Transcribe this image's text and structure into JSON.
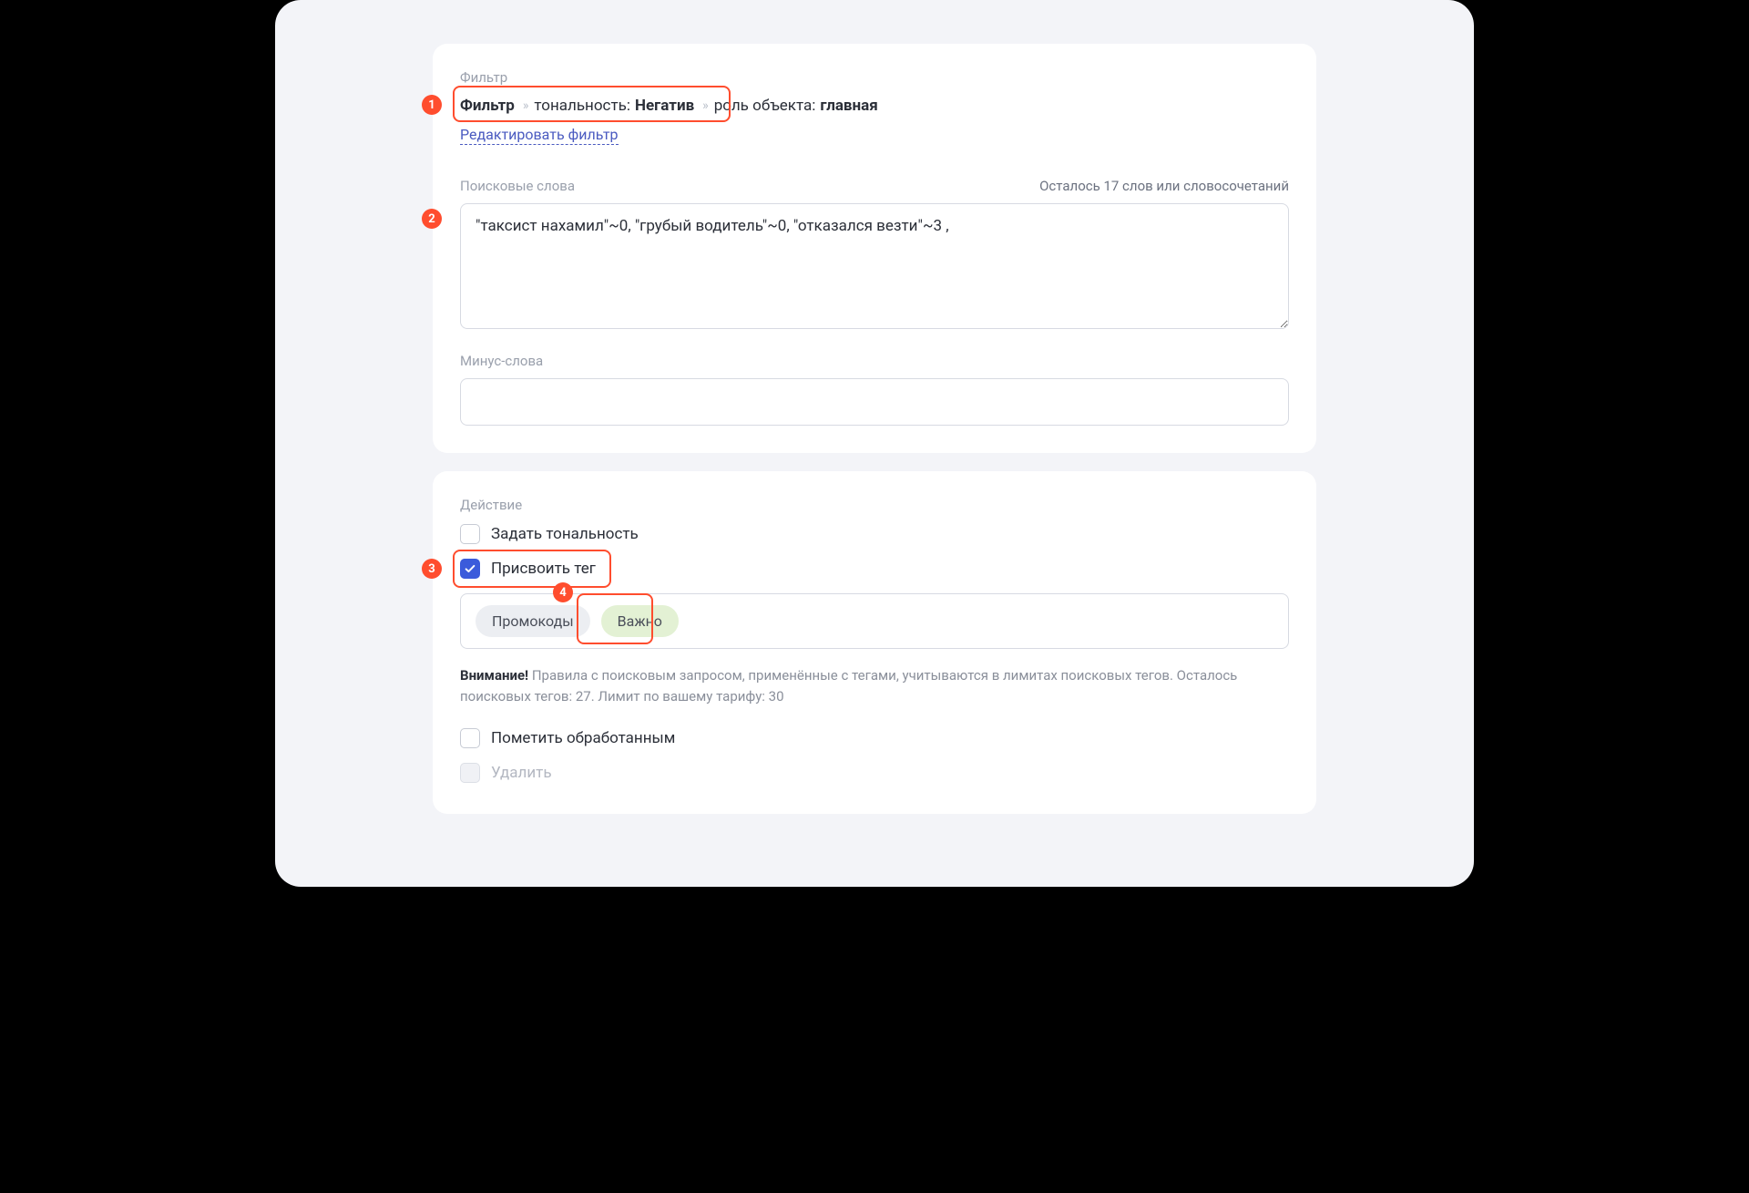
{
  "filter": {
    "section_label": "Фильтр",
    "breadcrumb": {
      "root": "Фильтр",
      "tonality_label": "тональность:",
      "tonality_value": "Негатив",
      "role_label": "роль объекта:",
      "role_value": "главная"
    },
    "edit_link": "Редактировать фильтр"
  },
  "search_words": {
    "label": "Поисковые слова",
    "remaining": "Осталось 17 слов или словосочетаний",
    "value": "\"таксист нахамил\"~0, \"грубый водитель\"~0, \"отказался везти\"~3 ,"
  },
  "minus_words": {
    "label": "Минус-слова",
    "value": ""
  },
  "action": {
    "section_label": "Действие",
    "set_tonality_label": "Задать тональность",
    "assign_tag_label": "Присвоить тег",
    "tags": {
      "tag1": "Промокоды",
      "tag2": "Важно"
    },
    "warning_strong": "Внимание!",
    "warning_rest": " Правила с поисковым запросом, применённые с тегами, учитываются в лимитах поисковых тегов. Осталось поисковых тегов: 27. Лимит по вашему тарифу: 30",
    "mark_processed_label": "Пометить обработанным",
    "delete_label": "Удалить"
  },
  "markers": {
    "m1": "1",
    "m2": "2",
    "m3": "3",
    "m4": "4"
  }
}
